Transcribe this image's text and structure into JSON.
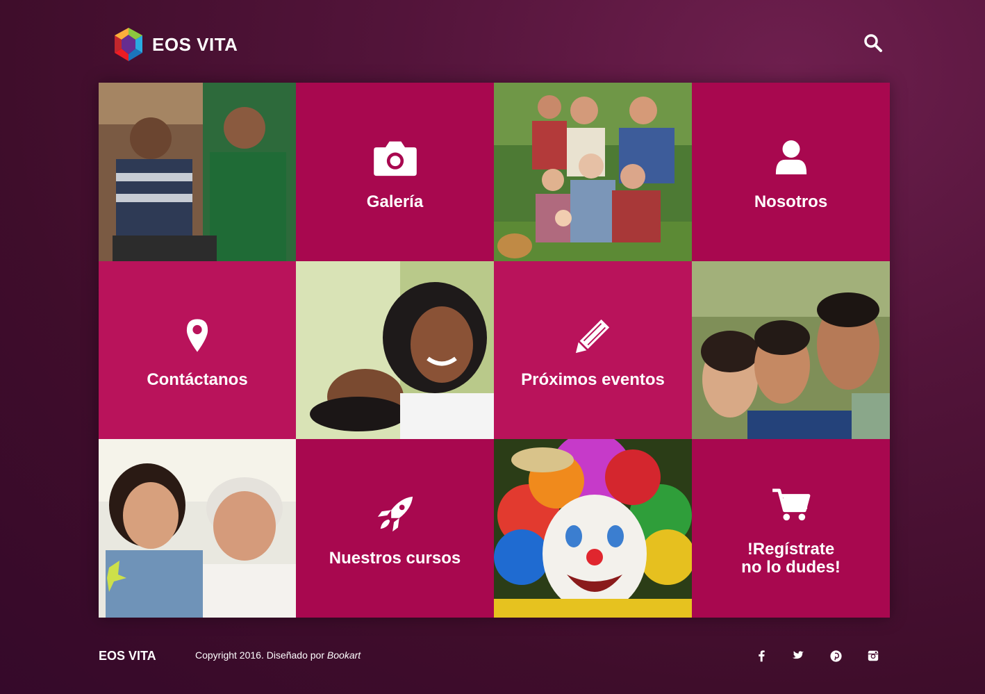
{
  "header": {
    "brand": "EOS VITA"
  },
  "colors": {
    "tile_magenta": "#a8084f",
    "tile_pink": "#b9135b",
    "background": "#4a1033"
  },
  "tiles": [
    {
      "type": "photo",
      "name": "family-photo-mother-son"
    },
    {
      "type": "menu",
      "label": "Galería",
      "icon": "camera-icon"
    },
    {
      "type": "photo",
      "name": "family-photo-group"
    },
    {
      "type": "menu",
      "label": "Nosotros",
      "icon": "user-icon"
    },
    {
      "type": "menu",
      "label": "Contáctanos",
      "icon": "map-pin-icon"
    },
    {
      "type": "photo",
      "name": "family-photo-laughing"
    },
    {
      "type": "menu",
      "label": "Próximos eventos",
      "icon": "pencil-icon"
    },
    {
      "type": "photo",
      "name": "family-photo-parents-child"
    },
    {
      "type": "photo",
      "name": "family-photo-father-daughter"
    },
    {
      "type": "menu",
      "label": "Nuestros cursos",
      "icon": "rocket-icon"
    },
    {
      "type": "photo",
      "name": "clown-photo"
    },
    {
      "type": "menu",
      "label_line1": "!Regístrate",
      "label_line2": "no lo dudes!",
      "icon": "cart-icon"
    }
  ],
  "footer": {
    "brand": "EOS VITA",
    "copyright_prefix": "Copyright 2016. Diseñado por ",
    "designer": "Bookart",
    "social": [
      "facebook-icon",
      "twitter-icon",
      "pinterest-icon",
      "instagram-icon"
    ]
  }
}
